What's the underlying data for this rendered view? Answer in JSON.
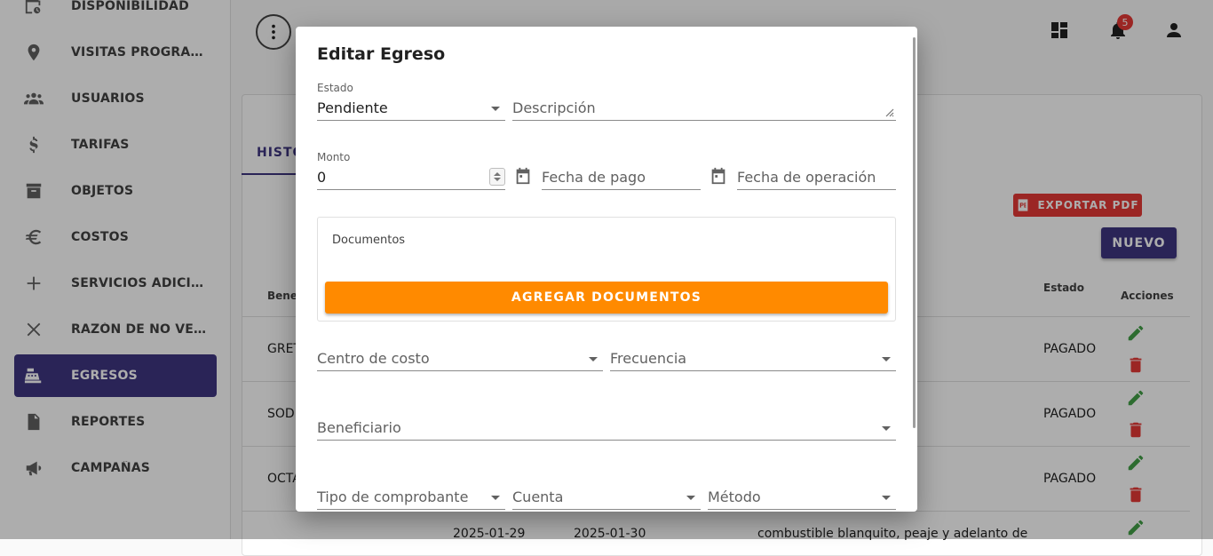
{
  "sidebar": {
    "items": [
      {
        "label": "DISPONIBILIDAD",
        "icon": "clock-calendar-icon"
      },
      {
        "label": "VISITAS PROGRAMADAS",
        "icon": "location-pin-icon"
      },
      {
        "label": "USUARIOS",
        "icon": "people-icon"
      },
      {
        "label": "TARIFAS",
        "icon": "dollar-icon"
      },
      {
        "label": "OBJETOS",
        "icon": "archive-box-icon"
      },
      {
        "label": "COSTOS",
        "icon": "euro-icon"
      },
      {
        "label": "SERVICIOS ADICIONALES",
        "icon": "plus-icon"
      },
      {
        "label": "RAZÓN DE NO VENTA",
        "icon": "close-icon"
      },
      {
        "label": "EGRESOS",
        "icon": "cash-register-icon",
        "active": true
      },
      {
        "label": "REPORTES",
        "icon": "report-document-icon"
      },
      {
        "label": "CAMPAÑAS",
        "icon": "megaphone-icon"
      }
    ]
  },
  "topbar": {
    "notification_count": "5"
  },
  "main": {
    "tab": "HISTO",
    "export_label": "EXPORTAR PDF",
    "nuevo_label": "NUEVO",
    "columns": {
      "benef": "Benef",
      "estado": "Estado",
      "acciones": "Acciones"
    },
    "rows": [
      {
        "benef": "GRET",
        "estado": "PAGADO"
      },
      {
        "benef": "SODI",
        "estado": "PAGADO"
      },
      {
        "benef": "OCTA",
        "estado": "PAGADO"
      }
    ],
    "partial_row": {
      "date1": "2025-01-29",
      "date2": "2025-01-30",
      "desc": "combustible blanquito, peaje y adelanto de"
    }
  },
  "dialog": {
    "title": "Editar Egreso",
    "estado": {
      "label": "Estado",
      "value": "Pendiente"
    },
    "descripcion": {
      "placeholder": "Descripción"
    },
    "monto": {
      "label": "Monto",
      "value": "0"
    },
    "fecha_pago": {
      "placeholder": "Fecha de pago"
    },
    "fecha_operacion": {
      "placeholder": "Fecha de operación"
    },
    "documentos": {
      "label": "Documentos",
      "button": "AGREGAR DOCUMENTOS"
    },
    "centro_costo": {
      "placeholder": "Centro de costo"
    },
    "frecuencia": {
      "placeholder": "Frecuencia"
    },
    "beneficiario": {
      "placeholder": "Beneficiario"
    },
    "tipo_comprobante": {
      "placeholder": "Tipo de comprobante"
    },
    "cuenta": {
      "placeholder": "Cuenta"
    },
    "metodo": {
      "placeholder": "Método"
    }
  },
  "colors": {
    "primary": "#3f3580",
    "accent": "#ff8a00",
    "danger": "#e53935",
    "success": "#43a047"
  }
}
